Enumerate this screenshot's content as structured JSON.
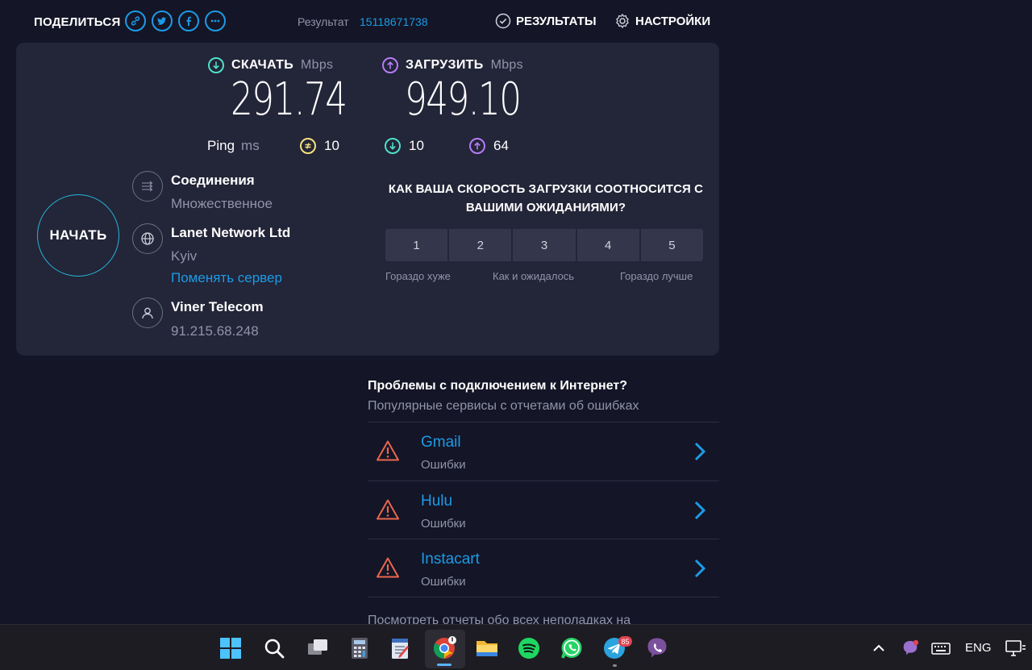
{
  "header": {
    "share_label": "ПОДЕЛИТЬСЯ",
    "share_icons": [
      "link-icon",
      "twitter-icon",
      "facebook-icon",
      "more-icon"
    ],
    "result_label": "Результат",
    "result_id": "15118671738",
    "results_label": "РЕЗУЛЬТАТЫ",
    "settings_label": "НАСТРОЙКИ"
  },
  "download": {
    "label": "СКАЧАТЬ",
    "unit": "Mbps",
    "value": "291.74",
    "color": "#4ee0c8"
  },
  "upload": {
    "label": "ЗАГРУЗИТЬ",
    "unit": "Mbps",
    "value": "949.10",
    "color": "#b57cf6"
  },
  "ping": {
    "label": "Ping",
    "unit": "ms",
    "idle": "10",
    "download": "10",
    "upload": "64",
    "idle_color": "#f5e27a"
  },
  "start_button": "НАЧАТЬ",
  "connections": {
    "title": "Соединения",
    "value": "Множественное"
  },
  "server": {
    "name": "Lanet Network Ltd",
    "city": "Kyiv",
    "change_link": "Поменять сервер"
  },
  "isp": {
    "name": "Viner Telecom",
    "ip": "91.215.68.248"
  },
  "survey": {
    "question": "КАК ВАША СКОРОСТЬ ЗАГРУЗКИ СООТНОСИТСЯ С ВАШИМИ ОЖИДАНИЯМИ?",
    "options": [
      "1",
      "2",
      "3",
      "4",
      "5"
    ],
    "scale_low": "Гораздо хуже",
    "scale_mid": "Как и ожидалось",
    "scale_high": "Гораздо лучше"
  },
  "problems": {
    "title": "Проблемы с подключением к Интернет?",
    "subtitle": "Популярные сервисы с отчетами об ошибках",
    "items": [
      {
        "name": "Gmail",
        "status": "Ошибки"
      },
      {
        "name": "Hulu",
        "status": "Ошибки"
      },
      {
        "name": "Instacart",
        "status": "Ошибки"
      }
    ],
    "more": "Посмотреть отчеты обо всех неполадках на"
  },
  "taskbar": {
    "apps": [
      "windows-start-icon",
      "search-icon",
      "task-view-icon",
      "calculator-icon",
      "notepad-icon",
      "chrome-icon",
      "file-explorer-icon",
      "spotify-icon",
      "whatsapp-icon",
      "telegram-icon",
      "viber-icon"
    ],
    "telegram_badge": "85",
    "language": "ENG"
  },
  "colors": {
    "accent": "#1c9be6",
    "panel": "#232538",
    "background": "#141526",
    "warning": "#e8674e"
  }
}
